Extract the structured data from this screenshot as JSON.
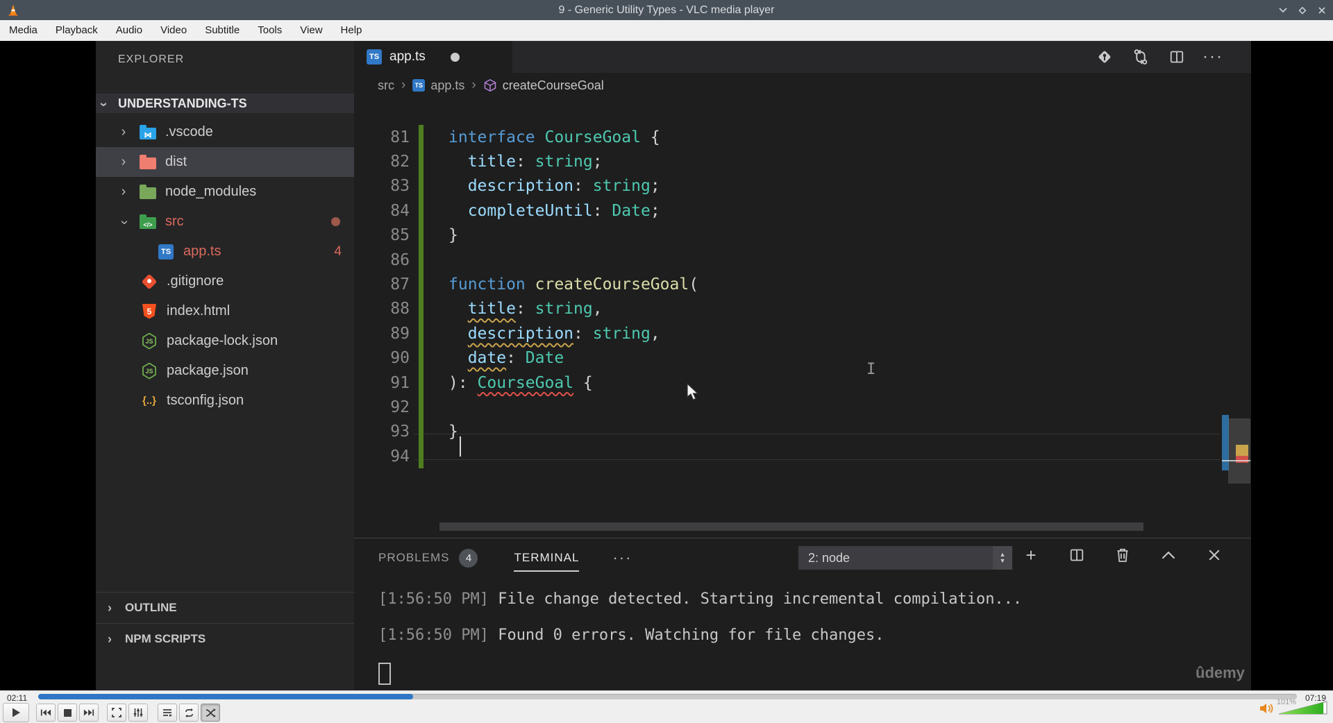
{
  "vlc": {
    "title": "9 - Generic Utility Types - VLC media player",
    "menu": [
      "Media",
      "Playback",
      "Audio",
      "Video",
      "Subtitle",
      "Tools",
      "View",
      "Help"
    ],
    "window_controls": [
      "minimize",
      "maximize",
      "close"
    ],
    "current_time": "02:11",
    "total_time": "07:19",
    "progress_pct": 29.8,
    "volume_label": "101%",
    "volume_fill_pct": 93,
    "controls": [
      "play",
      "previous",
      "stop",
      "next",
      "fullscreen",
      "extended-settings",
      "playlist",
      "loop",
      "shuffle"
    ],
    "colors": {
      "seek_fill": "#2f77c6",
      "titlebar": "#474f58",
      "volume_green": "#53c234",
      "speaker_orange": "#e8871e"
    }
  },
  "vscode": {
    "explorer": {
      "title": "EXPLORER",
      "workspace": "UNDERSTANDING-TS",
      "items": [
        {
          "label": ".vscode",
          "icon": "folder-vscode",
          "chevron": "collapsed",
          "kind": "folder"
        },
        {
          "label": "dist",
          "icon": "folder-dist",
          "chevron": "collapsed",
          "kind": "folder",
          "selected": true
        },
        {
          "label": "node_modules",
          "icon": "folder-node",
          "chevron": "collapsed",
          "kind": "folder"
        },
        {
          "label": "src",
          "icon": "folder-src",
          "chevron": "expanded",
          "kind": "folder",
          "modified": true,
          "dot": true
        },
        {
          "label": "app.ts",
          "icon": "file-ts",
          "kind": "file-nested",
          "modified": true,
          "badge": "4"
        },
        {
          "label": ".gitignore",
          "icon": "file-git",
          "kind": "file"
        },
        {
          "label": "index.html",
          "icon": "file-html",
          "kind": "file"
        },
        {
          "label": "package-lock.json",
          "icon": "file-node",
          "kind": "file"
        },
        {
          "label": "package.json",
          "icon": "file-node",
          "kind": "file"
        },
        {
          "label": "tsconfig.json",
          "icon": "file-tsconfig",
          "kind": "file"
        }
      ],
      "bottom_sections": [
        "OUTLINE",
        "NPM SCRIPTS"
      ]
    },
    "tab": {
      "label": "app.ts",
      "modified": true
    },
    "breadcrumb": [
      "src",
      "app.ts",
      "createCourseGoal"
    ],
    "code": {
      "lines": [
        {
          "n": "81",
          "tokens": [
            {
              "t": "interface",
              "c": "kw"
            },
            {
              "t": " "
            },
            {
              "t": "CourseGoal",
              "c": "type"
            },
            {
              "t": " {",
              "c": "pn"
            }
          ]
        },
        {
          "n": "82",
          "tokens": [
            {
              "t": "  "
            },
            {
              "t": "title",
              "c": "prop"
            },
            {
              "t": ": ",
              "c": "pn"
            },
            {
              "t": "string",
              "c": "type"
            },
            {
              "t": ";",
              "c": "pn"
            }
          ]
        },
        {
          "n": "83",
          "tokens": [
            {
              "t": "  "
            },
            {
              "t": "description",
              "c": "prop"
            },
            {
              "t": ": ",
              "c": "pn"
            },
            {
              "t": "string",
              "c": "type"
            },
            {
              "t": ";",
              "c": "pn"
            }
          ]
        },
        {
          "n": "84",
          "tokens": [
            {
              "t": "  "
            },
            {
              "t": "completeUntil",
              "c": "prop"
            },
            {
              "t": ": ",
              "c": "pn"
            },
            {
              "t": "Date",
              "c": "type"
            },
            {
              "t": ";",
              "c": "pn"
            }
          ]
        },
        {
          "n": "85",
          "tokens": [
            {
              "t": "}",
              "c": "pn"
            }
          ]
        },
        {
          "n": "86",
          "tokens": []
        },
        {
          "n": "87",
          "tokens": [
            {
              "t": "function",
              "c": "kw"
            },
            {
              "t": " "
            },
            {
              "t": "createCourseGoal",
              "c": "fn"
            },
            {
              "t": "(",
              "c": "pn"
            }
          ]
        },
        {
          "n": "88",
          "tokens": [
            {
              "t": "  "
            },
            {
              "t": "title",
              "c": "prop",
              "u": "warn"
            },
            {
              "t": ": ",
              "c": "pn"
            },
            {
              "t": "string",
              "c": "type"
            },
            {
              "t": ",",
              "c": "pn"
            }
          ]
        },
        {
          "n": "89",
          "tokens": [
            {
              "t": "  "
            },
            {
              "t": "description",
              "c": "prop",
              "u": "warn"
            },
            {
              "t": ": ",
              "c": "pn"
            },
            {
              "t": "string",
              "c": "type"
            },
            {
              "t": ",",
              "c": "pn"
            }
          ]
        },
        {
          "n": "90",
          "tokens": [
            {
              "t": "  "
            },
            {
              "t": "date",
              "c": "prop",
              "u": "warn"
            },
            {
              "t": ": ",
              "c": "pn"
            },
            {
              "t": "Date",
              "c": "type"
            }
          ]
        },
        {
          "n": "91",
          "tokens": [
            {
              "t": "): ",
              "c": "pn"
            },
            {
              "t": "CourseGoal",
              "c": "type",
              "u": "err"
            },
            {
              "t": " {",
              "c": "pn"
            }
          ]
        },
        {
          "n": "92",
          "tokens": [],
          "current": true,
          "cursor": true
        },
        {
          "n": "93",
          "tokens": [
            {
              "t": "}",
              "c": "pn"
            }
          ]
        },
        {
          "n": "94",
          "tokens": []
        }
      ],
      "syntax_colors": {
        "keyword": "#569cd6",
        "type": "#4ec9b0",
        "property": "#9cdcfe",
        "function": "#dcdcaa",
        "default": "#d4d4d4",
        "line_number": "#8a8a8a",
        "git_added_bar": "#4f7e20",
        "warning_squiggle": "#c9a44d",
        "error_squiggle": "#e0524a"
      }
    },
    "panel": {
      "problems_label": "PROBLEMS",
      "problems_badge": "4",
      "terminal_label": "TERMINAL",
      "more_label": "···",
      "dropdown_value": "2: node",
      "action_icons": [
        "new-terminal",
        "split-terminal",
        "kill-terminal",
        "maximize-panel",
        "close-panel"
      ],
      "terminal_lines": [
        {
          "time": "[1:56:50 PM]",
          "text": " File change detected. Starting incremental compilation..."
        },
        {
          "time": "[1:56:50 PM]",
          "text": " Found 0 errors. Watching for file changes."
        }
      ]
    },
    "watermark": "ûdemy",
    "file_colors": {
      "modified_red": "#db6a5c",
      "ts_blue": "#3178c6",
      "symbol_purple": "#b180d7"
    }
  }
}
